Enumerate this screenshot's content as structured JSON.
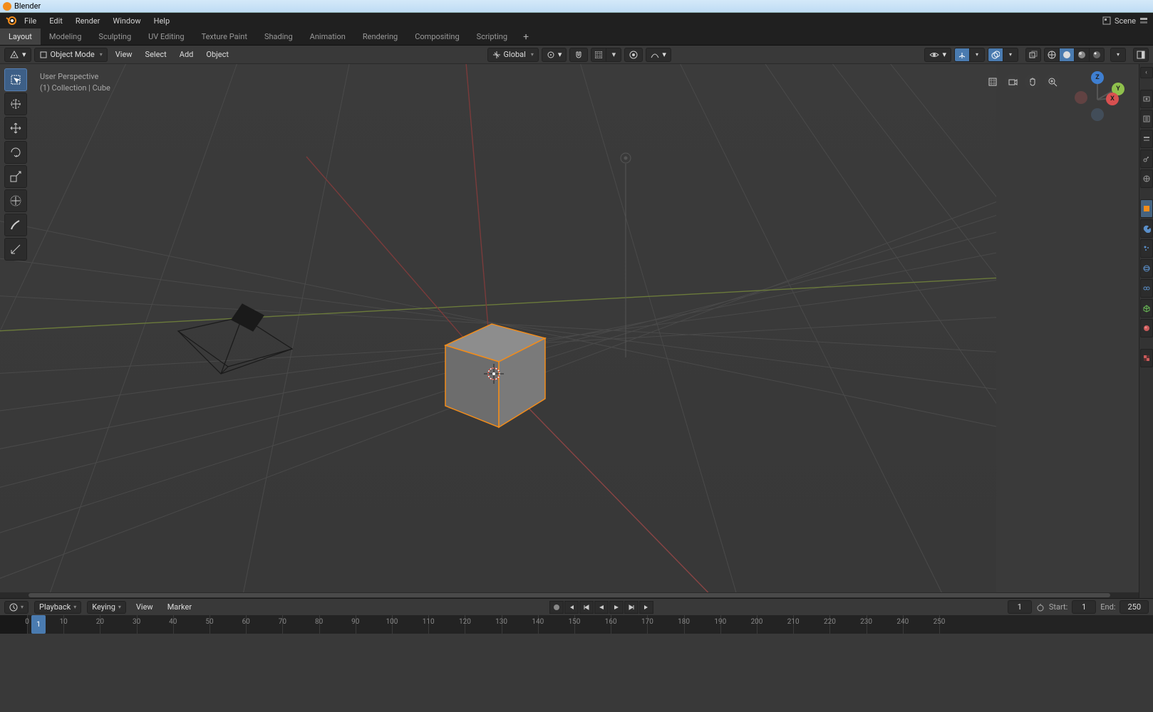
{
  "title": "Blender",
  "topmenu": [
    "File",
    "Edit",
    "Render",
    "Window",
    "Help"
  ],
  "scene_label": "Scene",
  "workspaces": {
    "items": [
      "Layout",
      "Modeling",
      "Sculpting",
      "UV Editing",
      "Texture Paint",
      "Shading",
      "Animation",
      "Rendering",
      "Compositing",
      "Scripting"
    ],
    "active": 0
  },
  "header": {
    "mode": "Object Mode",
    "menus": [
      "View",
      "Select",
      "Add",
      "Object"
    ],
    "orientation": "Global"
  },
  "overlay": {
    "line1": "User Perspective",
    "line2": "(1) Collection | Cube"
  },
  "gizmo": {
    "z": "Z",
    "x": "X",
    "y": "Y"
  },
  "timeline_header": {
    "playback": "Playback",
    "keying": "Keying",
    "menus": [
      "View",
      "Marker"
    ],
    "current": "1",
    "start_label": "Start:",
    "start": "1",
    "end_label": "End:",
    "end": "250"
  },
  "timeline": {
    "ticks": [
      0,
      10,
      20,
      30,
      40,
      50,
      60,
      70,
      80,
      90,
      100,
      110,
      120,
      130,
      140,
      150,
      160,
      170,
      180,
      190,
      200,
      210,
      220,
      230,
      240,
      250
    ],
    "cursor": "1"
  },
  "left_tools": [
    "select-box",
    "cursor",
    "move",
    "rotate",
    "scale",
    "transform",
    "annotate",
    "measure"
  ],
  "nav_overlay_icons": [
    "zoom-icon",
    "camera-view-icon",
    "pan-icon",
    "orbit-icon"
  ],
  "header_right_icons": [
    "selectability",
    "gizmo-toggle",
    "overlay-toggle",
    "xray",
    "shading-wire",
    "shading-solid",
    "shading-material",
    "shading-rendered"
  ],
  "prop_tabs": [
    "render",
    "output",
    "view-layer",
    "scene",
    "world",
    "object",
    "modifier",
    "particle",
    "physics",
    "constraint",
    "data",
    "material",
    "texture"
  ],
  "prop_active": 5,
  "colors": {
    "accent": "#4a7bb0",
    "orange": "#f28c1a",
    "axis_x": "#d85050",
    "axis_y": "#8fc04c",
    "axis_z": "#3f7fd1"
  }
}
